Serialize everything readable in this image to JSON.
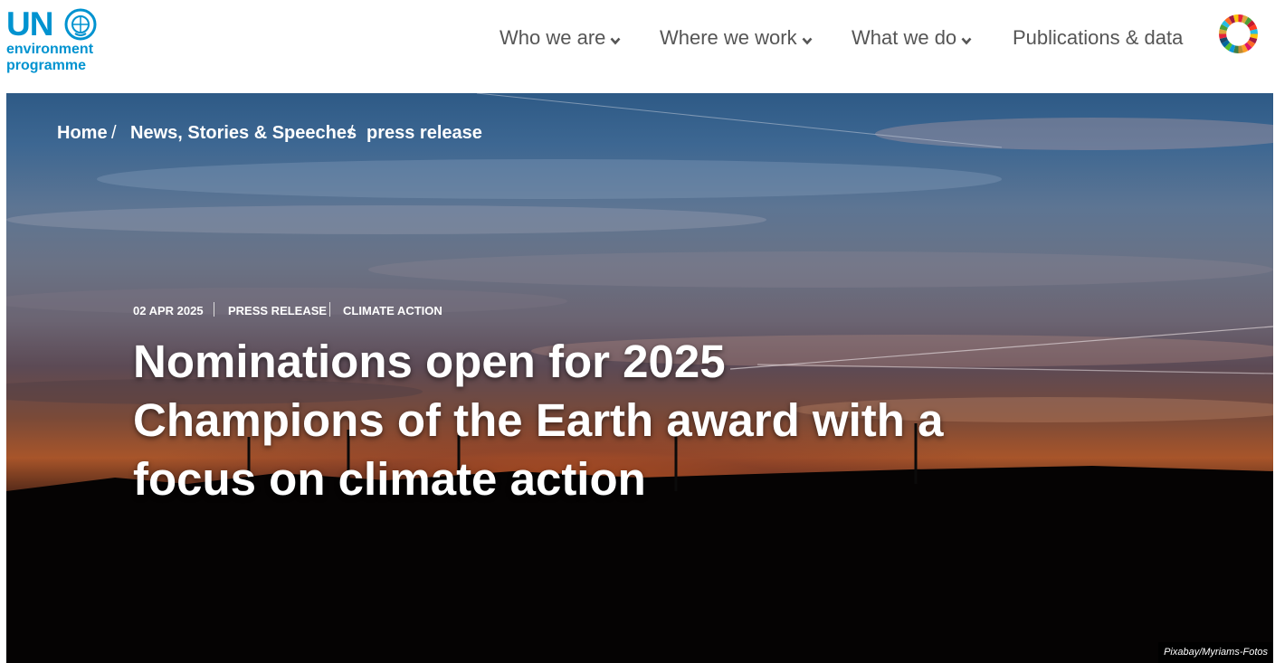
{
  "header": {
    "logo": {
      "un": "UN",
      "line1": "environment",
      "line2": "programme"
    },
    "nav": [
      {
        "label": "Who we are",
        "has_dropdown": true
      },
      {
        "label": "Where we work",
        "has_dropdown": true
      },
      {
        "label": "What we do",
        "has_dropdown": true
      },
      {
        "label": "Publications & data",
        "has_dropdown": false
      }
    ],
    "sdg_icon": "sdg-wheel-icon"
  },
  "breadcrumb": [
    {
      "label": "Home"
    },
    {
      "label": "News, Stories & Speeches"
    },
    {
      "label": "press release"
    }
  ],
  "article": {
    "date": "02 APR 2025",
    "type": "PRESS RELEASE",
    "topic": "CLIMATE ACTION",
    "title": "Nominations open for 2025 Champions of the Earth award with a focus on climate action"
  },
  "hero": {
    "photo_credit": "Pixabay/Myriams-Fotos"
  },
  "colors": {
    "brand": "#0093d0",
    "nav_text": "#555555",
    "hero_text": "#ffffff"
  }
}
